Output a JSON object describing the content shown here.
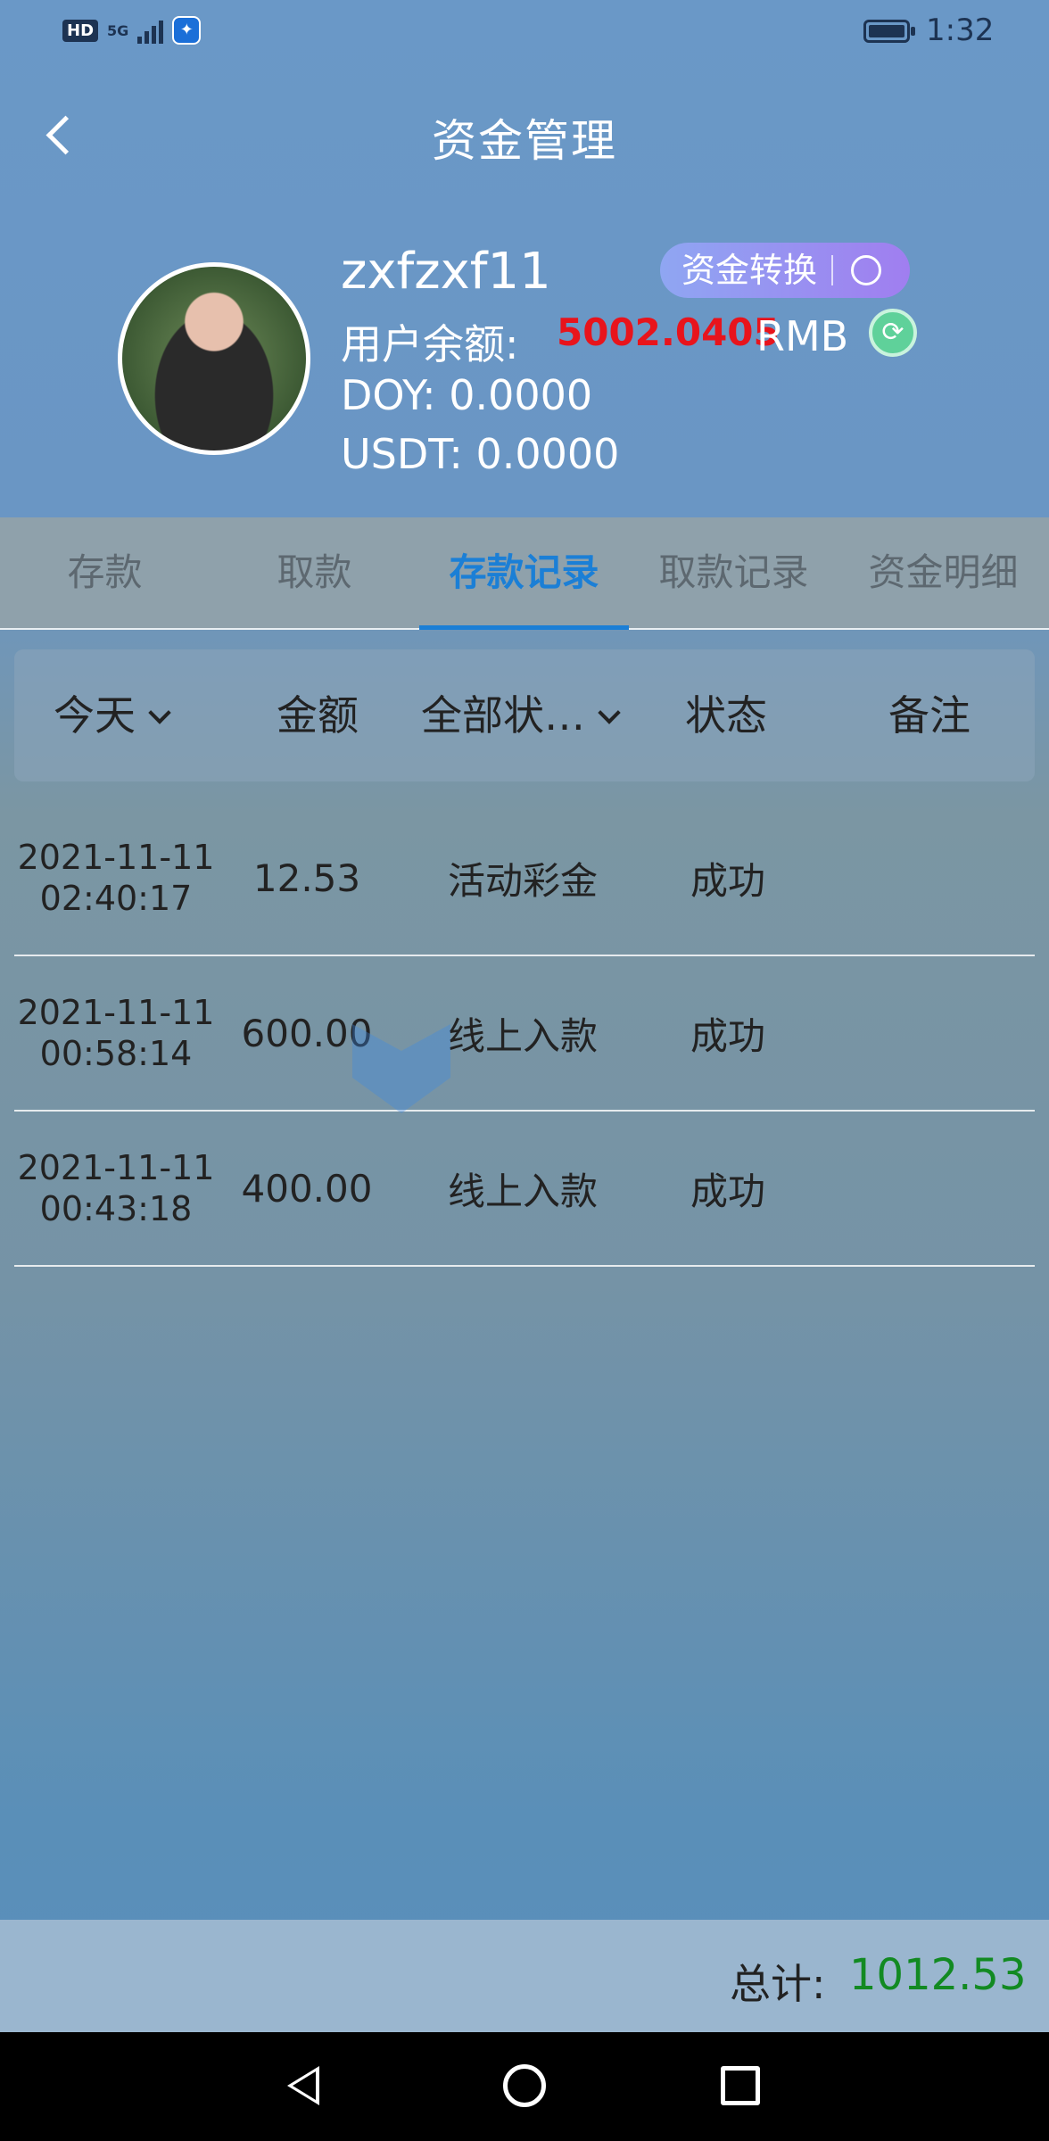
{
  "status_bar": {
    "hd": "HD",
    "network": "5G",
    "time": "1:32"
  },
  "header": {
    "title": "资金管理"
  },
  "profile": {
    "username": "zxfzxf11",
    "transfer_label": "资金转换",
    "balance_label": "用户余额:",
    "balance_value": "5002.0405",
    "balance_unit": "RMB",
    "doy": "DOY:  0.0000",
    "usdt": "USDT:  0.0000",
    "colors": {
      "balance": "#e8141c",
      "accent": "#1b7fd6",
      "total": "#128a22"
    }
  },
  "tabs": [
    {
      "label": "存款"
    },
    {
      "label": "取款"
    },
    {
      "label": "存款记录",
      "active": true
    },
    {
      "label": "取款记录"
    },
    {
      "label": "资金明细"
    }
  ],
  "filters": {
    "date": "今天",
    "amount": "金额",
    "type": "全部状…",
    "status": "状态",
    "remark": "备注"
  },
  "records": [
    {
      "date": "2021-11-11",
      "time": "02:40:17",
      "amount": "12.53",
      "type": "活动彩金",
      "status": "成功",
      "remark": ""
    },
    {
      "date": "2021-11-11",
      "time": "00:58:14",
      "amount": "600.00",
      "type": "线上入款",
      "status": "成功",
      "remark": ""
    },
    {
      "date": "2021-11-11",
      "time": "00:43:18",
      "amount": "400.00",
      "type": "线上入款",
      "status": "成功",
      "remark": ""
    }
  ],
  "total": {
    "label": "总计:",
    "value": "1012.53"
  }
}
